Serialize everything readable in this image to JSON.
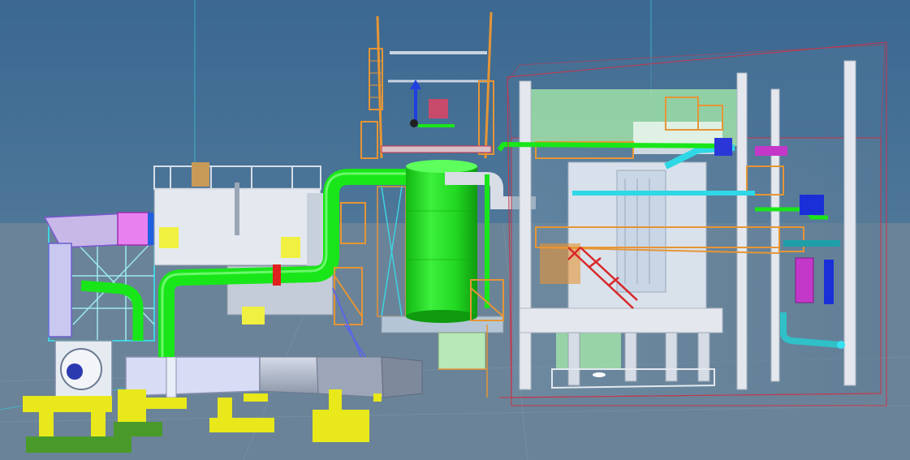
{
  "scene": {
    "type": "3d-plant-model-render",
    "colors": {
      "sky_top": "#3f6a8f",
      "sky_horizon": "#6f8aa3",
      "ground": "#6d8599",
      "main_pipe": "#19e619",
      "absorber_tower": "#20e020",
      "steel_orange": "#e69535",
      "support_yellow": "#e8e81a",
      "duct_grey": "#b9c3d6",
      "building_wall": "#dfe5ee",
      "cyan_pipe": "#2fd8e6",
      "stair_red": "#d8282a",
      "enclosure_line": "#c8344a",
      "magenta": "#c338c8",
      "blue_duct": "#1a2fd8"
    }
  }
}
